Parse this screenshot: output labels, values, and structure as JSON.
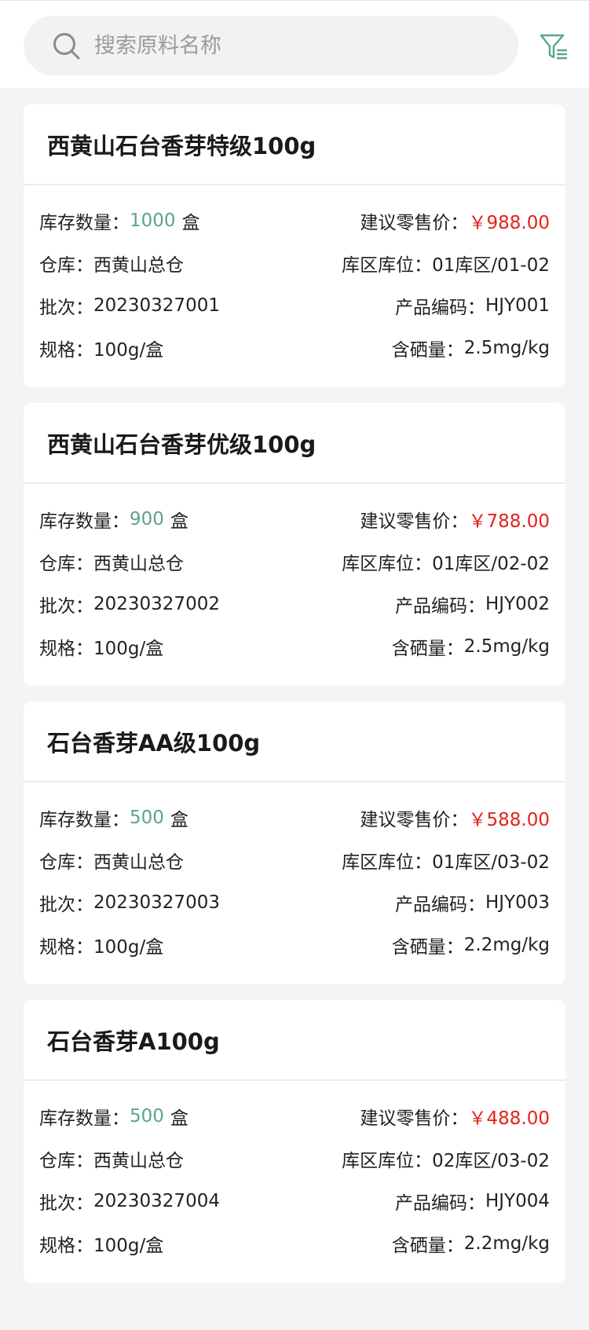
{
  "search": {
    "placeholder": "搜索原料名称"
  },
  "colors": {
    "accent": "#5ea584",
    "price": "#e2231a",
    "background": "#f3f4f6"
  },
  "labels": {
    "stock": "库存数量：",
    "unit": "盒",
    "price": "建议零售价：",
    "warehouse": "仓库：",
    "location": "库区库位：",
    "batch": "批次：",
    "code": "产品编码：",
    "spec": "规格：",
    "selenium": "含硒量："
  },
  "products": [
    {
      "name": "西黄山石台香芽特级100g",
      "stock": "1000",
      "price": "￥988.00",
      "warehouse": "西黄山总仓",
      "location": "01库区/01-02",
      "batch": "20230327001",
      "code": "HJY001",
      "spec": "100g/盒",
      "selenium": "2.5mg/kg"
    },
    {
      "name": "西黄山石台香芽优级100g",
      "stock": "900",
      "price": "￥788.00",
      "warehouse": "西黄山总仓",
      "location": "01库区/02-02",
      "batch": "20230327002",
      "code": "HJY002",
      "spec": "100g/盒",
      "selenium": "2.5mg/kg"
    },
    {
      "name": "石台香芽AA级100g",
      "stock": "500",
      "price": "￥588.00",
      "warehouse": "西黄山总仓",
      "location": "01库区/03-02",
      "batch": "20230327003",
      "code": "HJY003",
      "spec": "100g/盒",
      "selenium": "2.2mg/kg"
    },
    {
      "name": "石台香芽A100g",
      "stock": "500",
      "price": "￥488.00",
      "warehouse": "西黄山总仓",
      "location": "02库区/03-02",
      "batch": "20230327004",
      "code": "HJY004",
      "spec": "100g/盒",
      "selenium": "2.2mg/kg"
    }
  ]
}
